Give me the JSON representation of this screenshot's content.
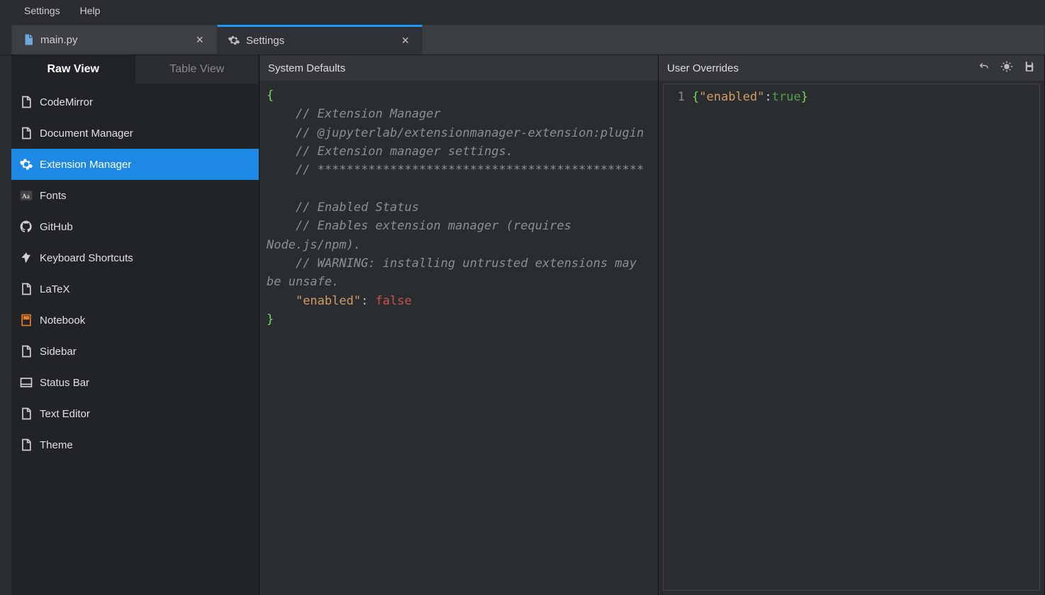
{
  "menubar": {
    "settings": "Settings",
    "help": "Help"
  },
  "tabs": [
    {
      "label": "main.py",
      "active": false
    },
    {
      "label": "Settings",
      "active": true
    }
  ],
  "viewTabs": {
    "raw": "Raw View",
    "table": "Table View"
  },
  "plugins": [
    {
      "label": "CodeMirror",
      "icon": "file-icon"
    },
    {
      "label": "Document Manager",
      "icon": "file-icon"
    },
    {
      "label": "Extension Manager",
      "icon": "gear-icon",
      "selected": true
    },
    {
      "label": "Fonts",
      "icon": "fonts-icon"
    },
    {
      "label": "GitHub",
      "icon": "github-icon"
    },
    {
      "label": "Keyboard Shortcuts",
      "icon": "keyboard-icon"
    },
    {
      "label": "LaTeX",
      "icon": "file-icon"
    },
    {
      "label": "Notebook",
      "icon": "notebook-icon"
    },
    {
      "label": "Sidebar",
      "icon": "file-icon"
    },
    {
      "label": "Status Bar",
      "icon": "statusbar-icon"
    },
    {
      "label": "Text Editor",
      "icon": "file-icon"
    },
    {
      "label": "Theme",
      "icon": "file-icon"
    }
  ],
  "panes": {
    "defaults_title": "System Defaults",
    "overrides_title": "User Overrides"
  },
  "defaults_code": {
    "c1": "// Extension Manager",
    "c2": "// @jupyterlab/extensionmanager-extension:plugin",
    "c3": "// Extension manager settings.",
    "c4": "// *********************************************",
    "c5": "// Enabled Status",
    "c6": "// Enables extension manager (requires Node.js/npm).",
    "c7": "// WARNING: installing untrusted extensions may be unsafe.",
    "key": "\"enabled\"",
    "colon": ": ",
    "val": "false"
  },
  "overrides_code": {
    "line_no": "1",
    "open": "{",
    "key": "\"enabled\"",
    "colon": ":",
    "val": "true",
    "close": "}"
  }
}
